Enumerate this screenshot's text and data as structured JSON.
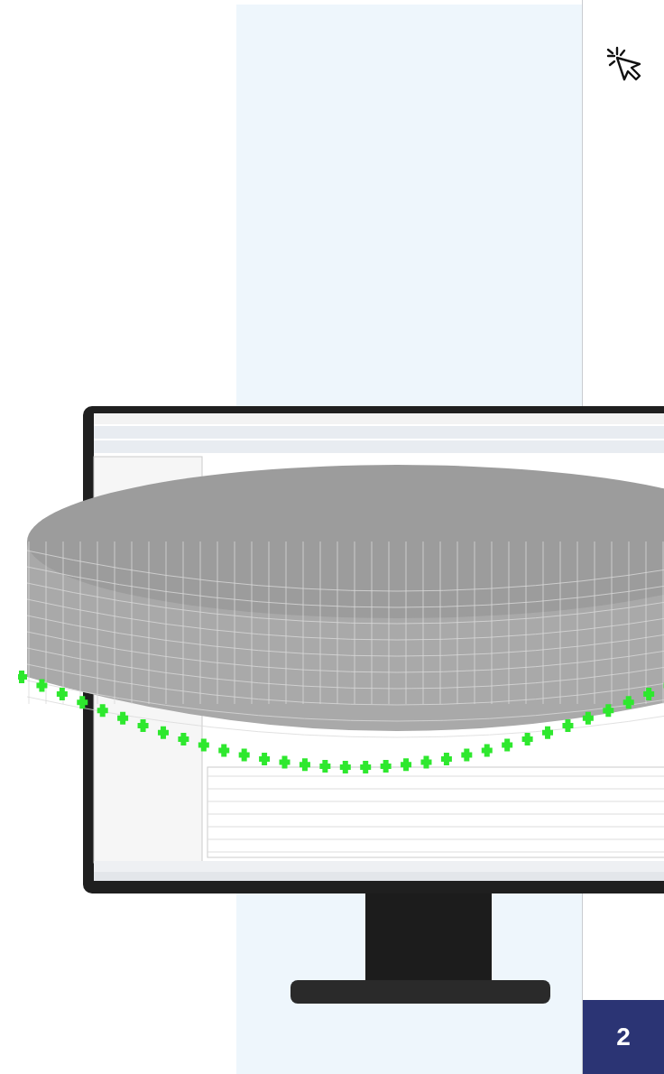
{
  "step_badge": {
    "label": "2"
  }
}
